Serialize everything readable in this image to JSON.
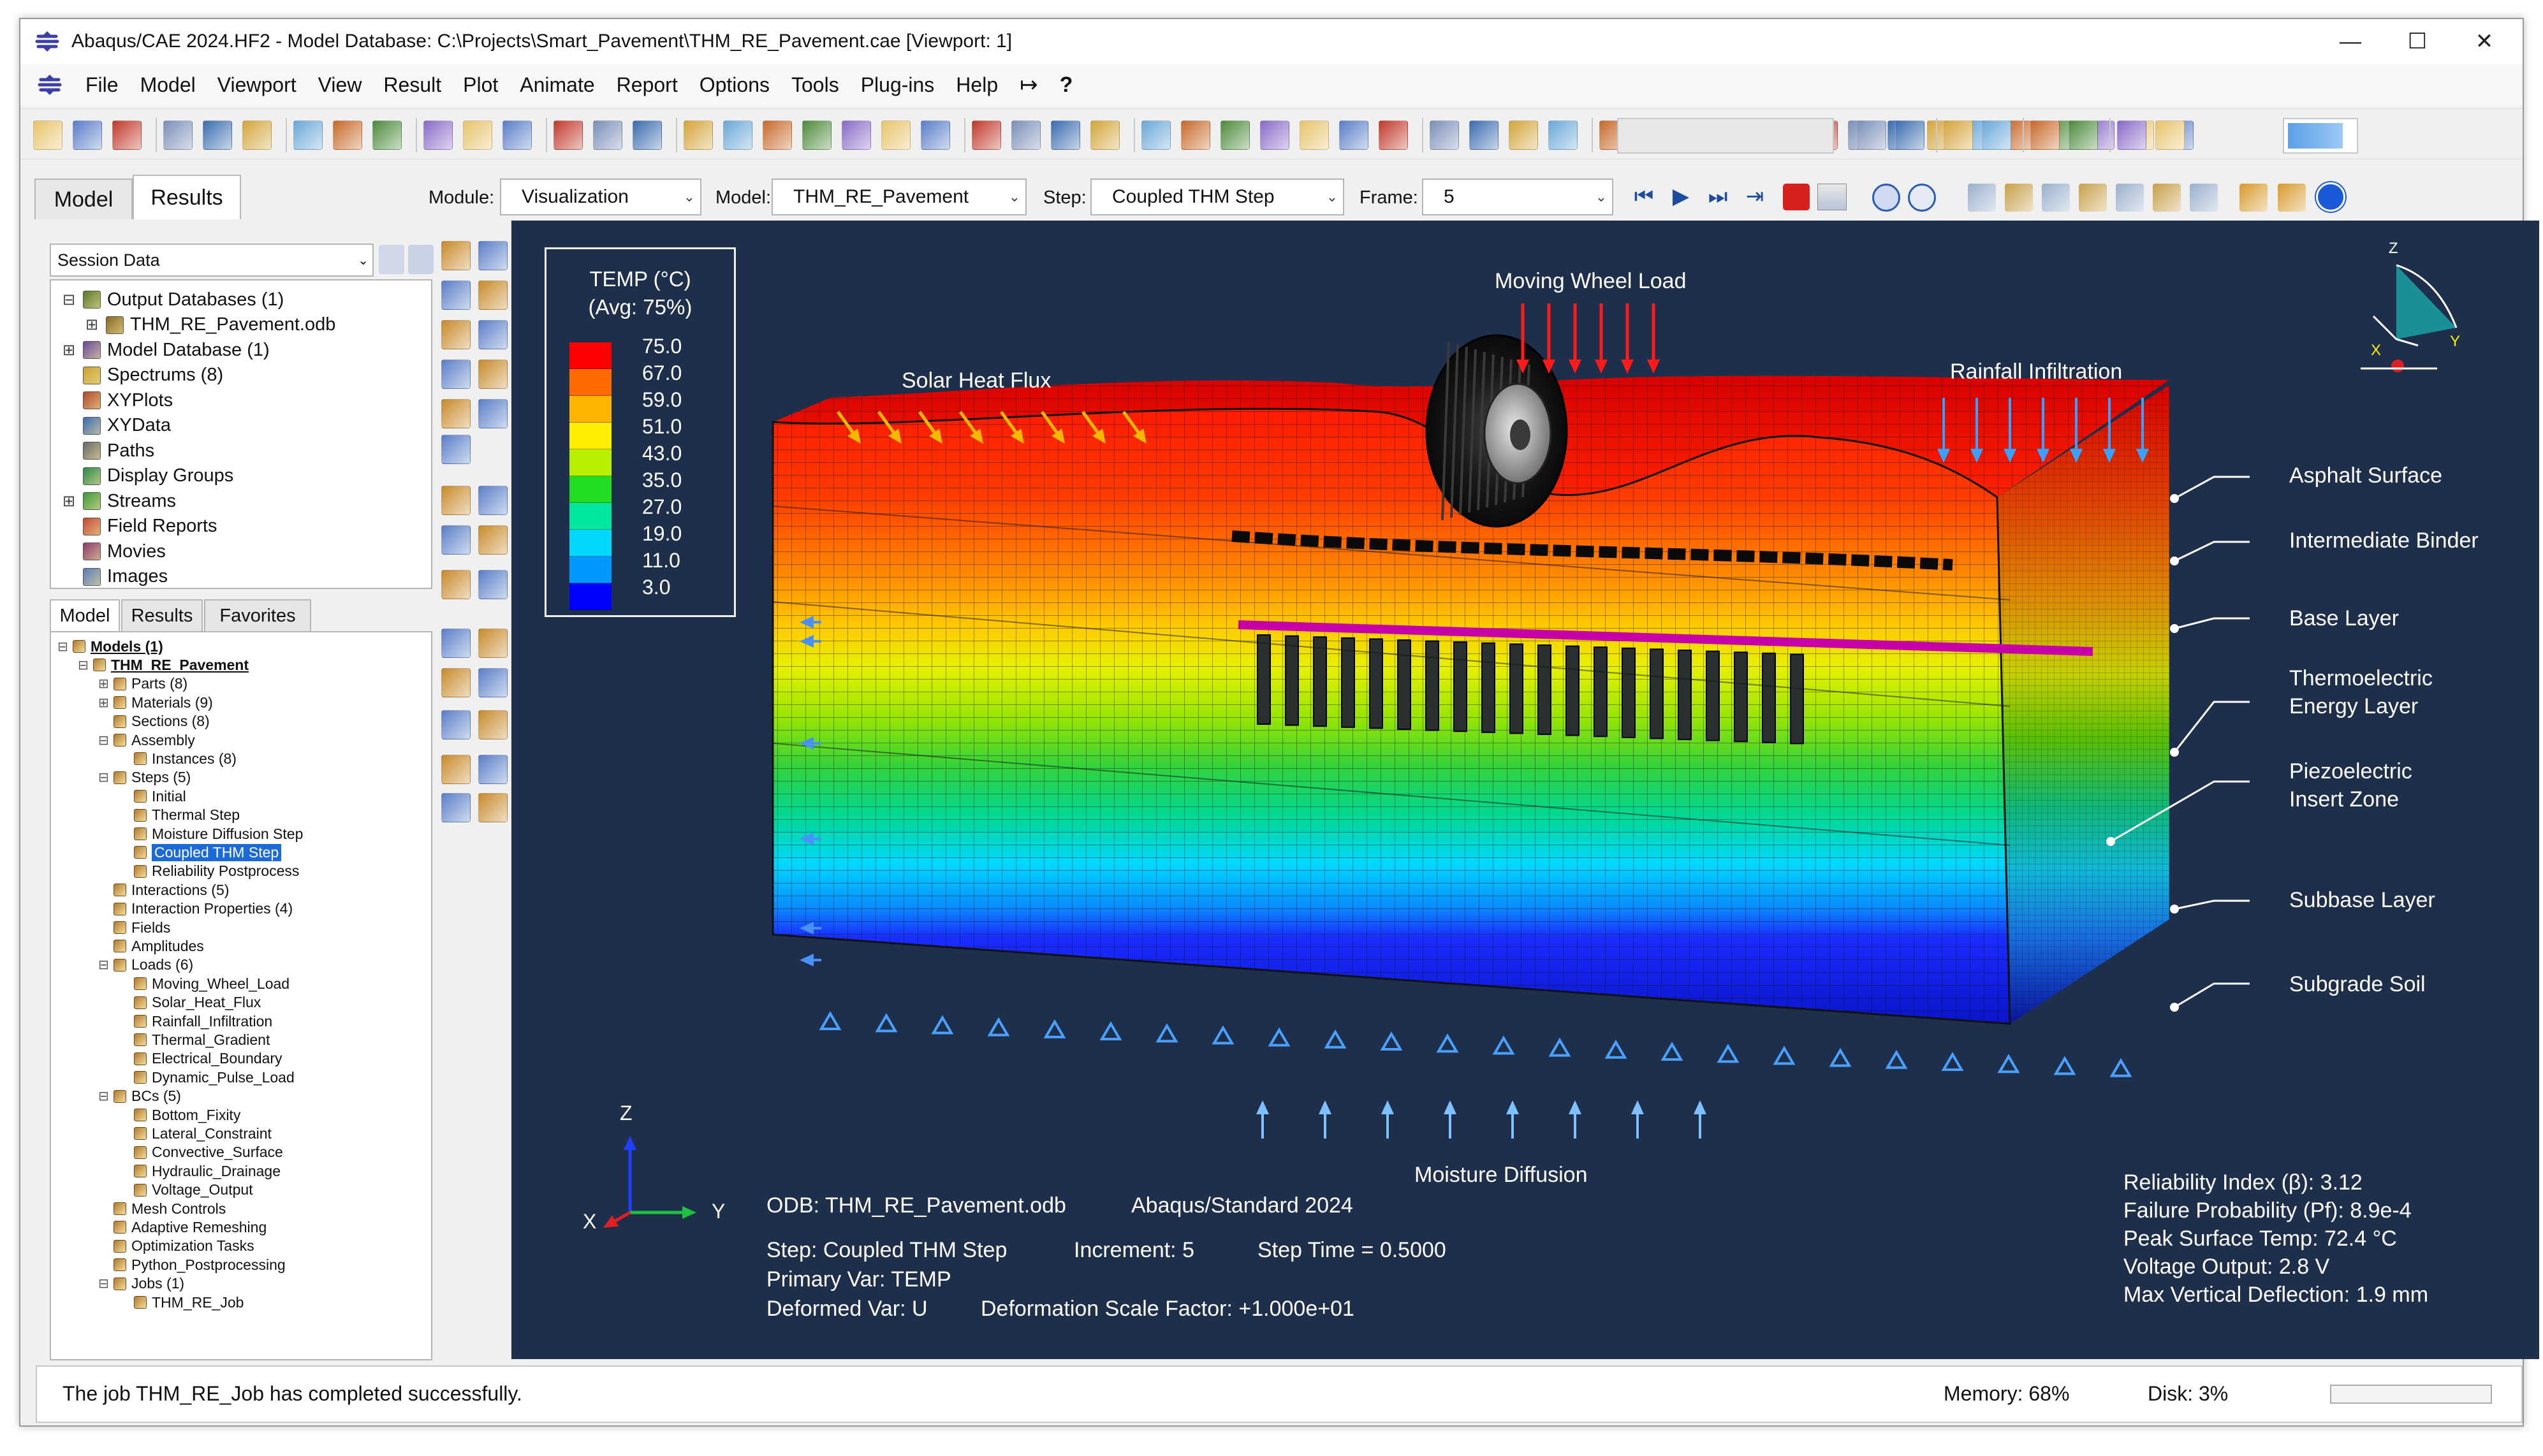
{
  "window": {
    "title": "Abaqus/CAE 2024.HF2 - Model Database: C:\\Projects\\Smart_Pavement\\THM_RE_Pavement.cae [Viewport: 1]",
    "controls": [
      "—",
      "☐",
      "✕"
    ]
  },
  "menu": {
    "file": "File",
    "model": "Model",
    "viewport": "Viewport",
    "view": "View",
    "result": "Result",
    "plot": "Plot",
    "animate": "Animate",
    "report": "Report",
    "options": "Options",
    "tools": "Tools",
    "plugins": "Plug-ins",
    "help": "Help"
  },
  "context": {
    "tab_model": "Model",
    "tab_results": "Results",
    "module_label": "Module:",
    "module_value": "Visualization",
    "model_label": "Model:",
    "model_value": "THM_RE_Pavement",
    "step_label": "Step:",
    "step_value": "Coupled THM Step",
    "frame_label": "Frame:",
    "frame_value": "5"
  },
  "session": {
    "selector": "Session Data",
    "items": [
      {
        "label": "Output Databases (1)",
        "expander": "⊟",
        "icon": "database-icon"
      },
      {
        "label": "THM_RE_Pavement.odb",
        "expander": "⊞",
        "icon": "odb-icon"
      },
      {
        "label": "Model Database (1)",
        "expander": "⊞",
        "icon": "model-db-icon"
      },
      {
        "label": "Spectrums (8)",
        "expander": "",
        "icon": "spectrum-icon"
      },
      {
        "label": "XYPlots",
        "expander": "",
        "icon": "xyplot-icon"
      },
      {
        "label": "XYData",
        "expander": "",
        "icon": "xydata-icon"
      },
      {
        "label": "Paths",
        "expander": "",
        "icon": "path-icon"
      },
      {
        "label": "Display Groups",
        "expander": "",
        "icon": "display-group-icon"
      },
      {
        "label": "Streams",
        "expander": "⊞",
        "icon": "stream-icon"
      },
      {
        "label": "Field Reports",
        "expander": "",
        "icon": "report-icon"
      },
      {
        "label": "Movies",
        "expander": "",
        "icon": "movie-icon"
      },
      {
        "label": "Images",
        "expander": "",
        "icon": "image-icon"
      }
    ]
  },
  "lower_tabs": {
    "model": "Model",
    "results": "Results",
    "favorites": "Favorites"
  },
  "model_tree": [
    {
      "label": "Models (1)",
      "level": 0,
      "exp": "⊟"
    },
    {
      "label": "THM_RE_Pavement",
      "level": 1,
      "exp": "⊟"
    },
    {
      "label": "Parts (8)",
      "level": 2,
      "exp": "⊞"
    },
    {
      "label": "Materials (9)",
      "level": 2,
      "exp": "⊞"
    },
    {
      "label": "Sections (8)",
      "level": 2,
      "exp": ""
    },
    {
      "label": "Assembly",
      "level": 2,
      "exp": "⊟"
    },
    {
      "label": "Instances (8)",
      "level": 3,
      "exp": ""
    },
    {
      "label": "Steps (5)",
      "level": 2,
      "exp": "⊟"
    },
    {
      "label": "Initial",
      "level": 3,
      "exp": ""
    },
    {
      "label": "Thermal Step",
      "level": 3,
      "exp": ""
    },
    {
      "label": "Moisture Diffusion Step",
      "level": 3,
      "exp": ""
    },
    {
      "label": "Coupled THM Step",
      "level": 3,
      "exp": "",
      "selected": true
    },
    {
      "label": "Reliability Postprocess",
      "level": 3,
      "exp": ""
    },
    {
      "label": "Interactions (5)",
      "level": 2,
      "exp": ""
    },
    {
      "label": "Interaction Properties (4)",
      "level": 2,
      "exp": ""
    },
    {
      "label": "Fields",
      "level": 2,
      "exp": ""
    },
    {
      "label": "Amplitudes",
      "level": 2,
      "exp": ""
    },
    {
      "label": "Loads (6)",
      "level": 2,
      "exp": "⊟"
    },
    {
      "label": "Moving_Wheel_Load",
      "level": 3,
      "exp": ""
    },
    {
      "label": "Solar_Heat_Flux",
      "level": 3,
      "exp": ""
    },
    {
      "label": "Rainfall_Infiltration",
      "level": 3,
      "exp": ""
    },
    {
      "label": "Thermal_Gradient",
      "level": 3,
      "exp": ""
    },
    {
      "label": "Electrical_Boundary",
      "level": 3,
      "exp": ""
    },
    {
      "label": "Dynamic_Pulse_Load",
      "level": 3,
      "exp": ""
    },
    {
      "label": "BCs (5)",
      "level": 2,
      "exp": "⊟"
    },
    {
      "label": "Bottom_Fixity",
      "level": 3,
      "exp": ""
    },
    {
      "label": "Lateral_Constraint",
      "level": 3,
      "exp": ""
    },
    {
      "label": "Convective_Surface",
      "level": 3,
      "exp": ""
    },
    {
      "label": "Hydraulic_Drainage",
      "level": 3,
      "exp": ""
    },
    {
      "label": "Voltage_Output",
      "level": 3,
      "exp": ""
    },
    {
      "label": "Mesh Controls",
      "level": 2,
      "exp": ""
    },
    {
      "label": "Adaptive Remeshing",
      "level": 2,
      "exp": ""
    },
    {
      "label": "Optimization Tasks",
      "level": 2,
      "exp": ""
    },
    {
      "label": "Python_Postprocessing",
      "level": 2,
      "exp": ""
    },
    {
      "label": "Jobs (1)",
      "level": 2,
      "exp": "⊟"
    },
    {
      "label": "THM_RE_Job",
      "level": 3,
      "exp": ""
    }
  ],
  "legend": {
    "title1": "TEMP (°C)",
    "title2": "(Avg: 75%)",
    "values": [
      "75.0",
      "67.0",
      "59.0",
      "51.0",
      "43.0",
      "35.0",
      "27.0",
      "19.0",
      "11.0",
      "3.0"
    ],
    "colors": [
      "#ff0000",
      "#ff6a00",
      "#ffb400",
      "#ffee00",
      "#b8f000",
      "#22dd22",
      "#00e8a0",
      "#00d8ff",
      "#0099ff",
      "#0000ff"
    ]
  },
  "viewport": {
    "load_labels": {
      "moving_wheel": "Moving Wheel Load",
      "solar": "Solar Heat Flux",
      "rain": "Rainfall Infiltration",
      "moisture": "Moisture Diffusion"
    },
    "layers": [
      "Asphalt Surface",
      "Intermediate Binder",
      "Base Layer",
      "Thermoelectric\nEnergy Layer",
      "Piezoelectric\nInsert Zone",
      "Subbase Layer",
      "Subgrade Soil"
    ],
    "triad": {
      "z": "Z",
      "x": "X",
      "y": "Y"
    },
    "view_cube": {
      "z": "Z",
      "x": "X",
      "y": "Y"
    },
    "odb_line": "ODB: THM_RE_Pavement.odb",
    "solver": "Abaqus/Standard 2024",
    "step_line": "Step: Coupled THM Step",
    "increment": "Increment: 5",
    "step_time": "Step Time = 0.5000",
    "primary": "Primary Var: TEMP",
    "deformed": "Deformed Var: U",
    "scale": "Deformation Scale Factor: +1.000e+01",
    "results": [
      "Reliability Index (β): 3.12",
      "Failure Probability (Pf): 8.9e-4",
      "Peak Surface Temp: 72.4 °C",
      "Voltage Output: 2.8 V",
      "Max Vertical Deflection: 1.9 mm"
    ]
  },
  "status": {
    "message": "The job THM_RE_Job has completed successfully.",
    "memory": "Memory:  68%",
    "disk": "Disk:  3%"
  }
}
